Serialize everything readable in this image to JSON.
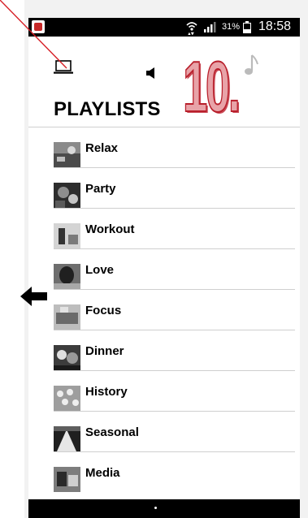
{
  "status_bar": {
    "battery_pct": "31%",
    "time": "18:58"
  },
  "header": {
    "badge_number": "10.",
    "title": "PLAYLISTS"
  },
  "playlists": [
    {
      "label": "Relax"
    },
    {
      "label": "Party"
    },
    {
      "label": "Workout"
    },
    {
      "label": "Love"
    },
    {
      "label": "Focus"
    },
    {
      "label": "Dinner"
    },
    {
      "label": "History"
    },
    {
      "label": "Seasonal"
    },
    {
      "label": "Media"
    }
  ],
  "colors": {
    "status_bar": "#000000",
    "badge_fill": "#e8a3a8",
    "badge_stroke": "#b81f2b",
    "divider": "#cfcfcf",
    "annotation_line": "#d62027"
  },
  "icons": [
    "app-icon",
    "wifi-icon",
    "signal-icon",
    "battery-icon",
    "laptop-icon",
    "speaker-icon",
    "music-note-icon",
    "back-arrow-icon"
  ]
}
